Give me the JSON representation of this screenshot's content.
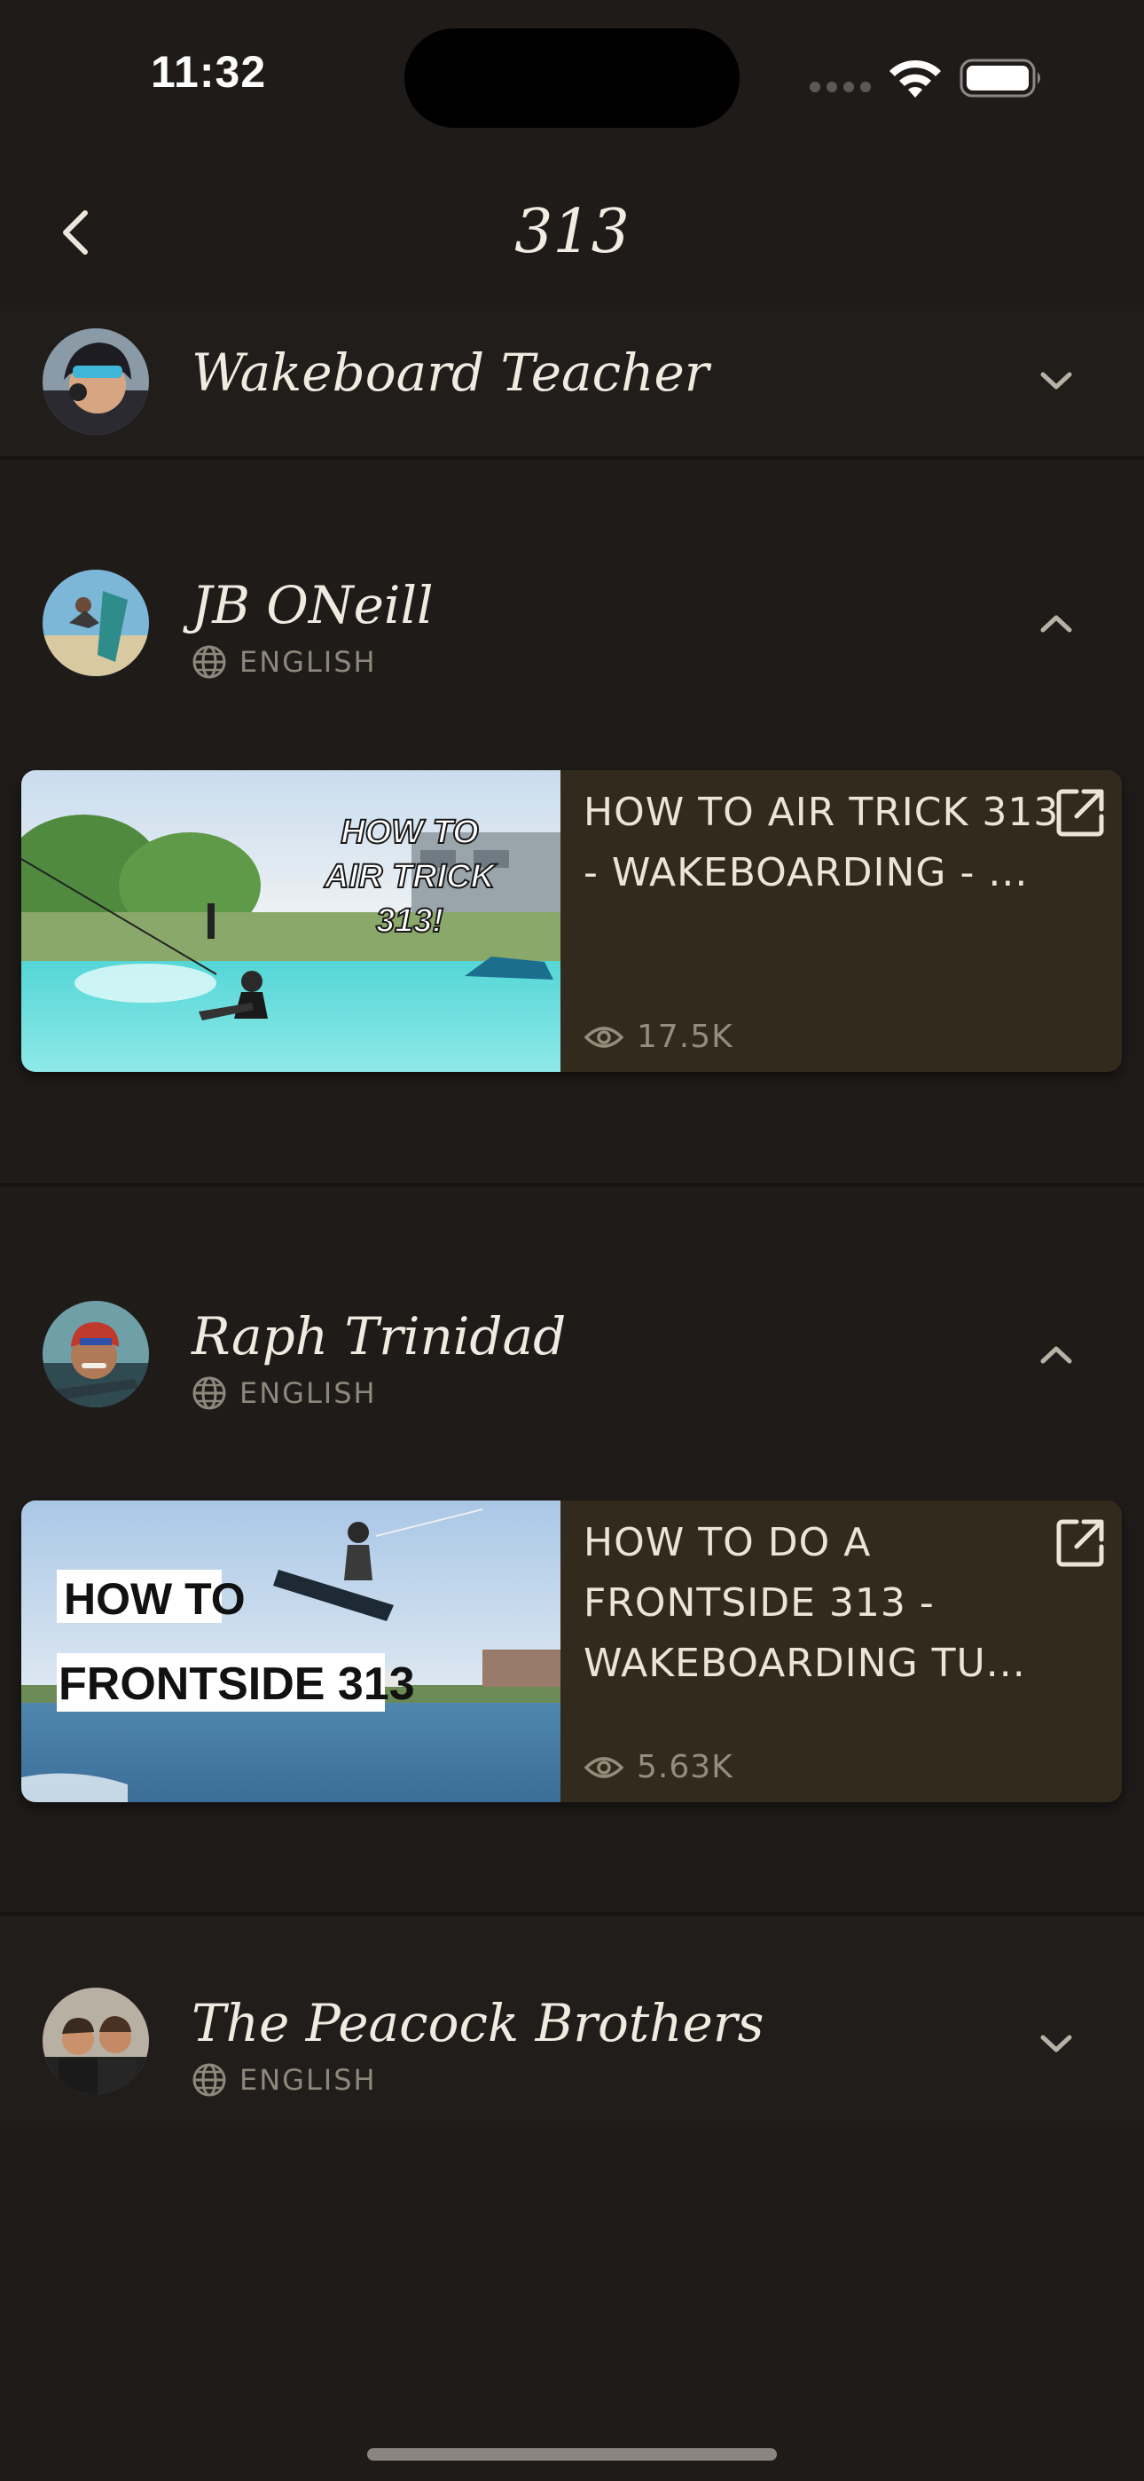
{
  "status_bar": {
    "time": "11:32"
  },
  "nav": {
    "title": "313"
  },
  "channels": [
    {
      "name": "Wakeboard Teacher",
      "expanded": false
    },
    {
      "name": "JB ONeill",
      "language": "ENGLISH",
      "expanded": true,
      "video": {
        "title": "HOW TO AIR TRICK 313 - WAKEBOARDING - ...",
        "views": "17.5K",
        "thumbnail_text": [
          "HOW TO",
          "AIR TRICK",
          "313!"
        ]
      }
    },
    {
      "name": "Raph Trinidad",
      "language": "ENGLISH",
      "expanded": true,
      "video": {
        "title": "HOW TO DO A FRONTSIDE 313 - WAKEBOARDING TU...",
        "views": "5.63K",
        "thumbnail_text": [
          "HOW TO",
          "FRONTSIDE 313"
        ]
      }
    },
    {
      "name": "The Peacock Brothers",
      "language": "ENGLISH",
      "expanded": false
    }
  ],
  "icons": {
    "back": "chevron-left-icon",
    "collapse": "chevron-up-icon",
    "expand": "chevron-down-icon",
    "language": "globe-icon",
    "views": "eye-icon",
    "open": "external-link-icon"
  },
  "colors": {
    "background": "#1e1b19",
    "video_card": "#322a1c",
    "text_primary": "#ece6dc",
    "text_muted": "#8e877c"
  }
}
